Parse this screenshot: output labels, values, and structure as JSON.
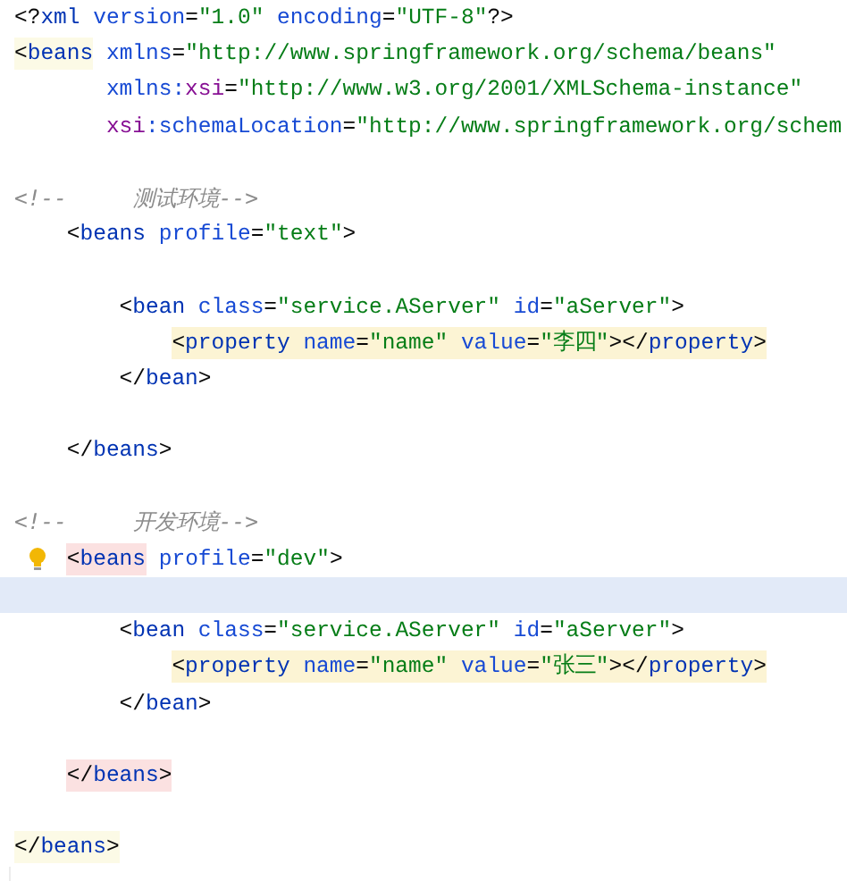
{
  "editor": {
    "lines": [
      {
        "kind": "code",
        "current": false,
        "bulb": false,
        "segments": [
          {
            "highlighted": false,
            "tokens": [
              {
                "kind": "punct",
                "text": "<?"
              },
              {
                "kind": "tag",
                "text": "xml"
              },
              {
                "kind": "attr",
                "text": " version"
              },
              {
                "kind": "punct",
                "text": "="
              },
              {
                "kind": "value",
                "text": "\"1.0\""
              },
              {
                "kind": "attr",
                "text": " encoding"
              },
              {
                "kind": "punct",
                "text": "="
              },
              {
                "kind": "value",
                "text": "\"UTF-8\""
              },
              {
                "kind": "punct",
                "text": "?>"
              }
            ]
          }
        ]
      },
      {
        "kind": "code",
        "current": false,
        "bulb": false,
        "segments": [
          {
            "highlighted": true,
            "color": "#fcfae6",
            "tokens": [
              {
                "kind": "punct",
                "text": "<"
              },
              {
                "kind": "tag",
                "text": "beans"
              }
            ]
          },
          {
            "highlighted": false,
            "tokens": [
              {
                "kind": "attr",
                "text": " xmlns"
              },
              {
                "kind": "punct",
                "text": "="
              },
              {
                "kind": "value",
                "text": "\"http://www.springframework.org/schema/beans\""
              }
            ]
          }
        ],
        "children": [
          {
            "kind": "continuation",
            "current": false,
            "bulb": false,
            "segments": [
              {
                "highlighted": false,
                "tokens": [
                  {
                    "kind": "attr",
                    "text": "xmlns:"
                  },
                  {
                    "kind": "ns",
                    "text": "xsi"
                  },
                  {
                    "kind": "punct",
                    "text": "="
                  },
                  {
                    "kind": "value",
                    "text": "\"http://www.w3.org/2001/XMLSchema-instance\""
                  }
                ]
              }
            ]
          },
          {
            "kind": "continuation",
            "current": false,
            "bulb": false,
            "segments": [
              {
                "highlighted": false,
                "tokens": [
                  {
                    "kind": "ns",
                    "text": "xsi"
                  },
                  {
                    "kind": "attr",
                    "text": ":schemaLocation"
                  },
                  {
                    "kind": "punct",
                    "text": "="
                  },
                  {
                    "kind": "value",
                    "text": "\"http://www.springframework.org/schem"
                  }
                ]
              }
            ]
          },
          {
            "kind": "blank",
            "current": false,
            "bulb": false
          },
          {
            "kind": "comment",
            "current": false,
            "bulb": false,
            "segments": [
              {
                "highlighted": false,
                "tokens": [
                  {
                    "kind": "comment",
                    "text": "<!--     测试环境-->"
                  }
                ]
              }
            ]
          },
          {
            "kind": "code",
            "current": false,
            "bulb": false,
            "segments": [
              {
                "highlighted": false,
                "tokens": [
                  {
                    "kind": "punct",
                    "text": "<"
                  },
                  {
                    "kind": "tag",
                    "text": "beans"
                  },
                  {
                    "kind": "attr",
                    "text": " profile"
                  },
                  {
                    "kind": "punct",
                    "text": "="
                  },
                  {
                    "kind": "value",
                    "text": "\"text\""
                  },
                  {
                    "kind": "punct",
                    "text": ">"
                  }
                ]
              }
            ],
            "children": [
              {
                "kind": "blank",
                "current": false,
                "bulb": false
              },
              {
                "kind": "code",
                "current": false,
                "bulb": false,
                "segments": [
                  {
                    "highlighted": false,
                    "tokens": [
                      {
                        "kind": "punct",
                        "text": "<"
                      },
                      {
                        "kind": "tag",
                        "text": "bean"
                      },
                      {
                        "kind": "attr",
                        "text": " class"
                      },
                      {
                        "kind": "punct",
                        "text": "="
                      },
                      {
                        "kind": "value",
                        "text": "\"service.AServer\""
                      },
                      {
                        "kind": "attr",
                        "text": " id"
                      },
                      {
                        "kind": "punct",
                        "text": "="
                      },
                      {
                        "kind": "value",
                        "text": "\"aServer\""
                      },
                      {
                        "kind": "punct",
                        "text": ">"
                      }
                    ]
                  }
                ],
                "children": [
                  {
                    "kind": "code",
                    "current": false,
                    "bulb": false,
                    "segments": [
                      {
                        "highlighted": true,
                        "color": "#fcf4d4",
                        "tokens": [
                          {
                            "kind": "punct",
                            "text": "<"
                          },
                          {
                            "kind": "tag",
                            "text": "property"
                          },
                          {
                            "kind": "attr",
                            "text": " name"
                          },
                          {
                            "kind": "punct",
                            "text": "="
                          },
                          {
                            "kind": "value",
                            "text": "\"name\""
                          },
                          {
                            "kind": "attr",
                            "text": " value"
                          },
                          {
                            "kind": "punct",
                            "text": "="
                          },
                          {
                            "kind": "value",
                            "text": "\"李四\""
                          },
                          {
                            "kind": "punct",
                            "text": "></"
                          },
                          {
                            "kind": "tag",
                            "text": "property"
                          },
                          {
                            "kind": "punct",
                            "text": ">"
                          }
                        ]
                      }
                    ]
                  }
                ]
              },
              {
                "kind": "code",
                "current": false,
                "bulb": false,
                "segments": [
                  {
                    "highlighted": false,
                    "tokens": [
                      {
                        "kind": "punct",
                        "text": "</"
                      },
                      {
                        "kind": "tag",
                        "text": "bean"
                      },
                      {
                        "kind": "punct",
                        "text": ">"
                      }
                    ]
                  }
                ]
              },
              {
                "kind": "blank",
                "current": false,
                "bulb": false
              }
            ]
          },
          {
            "kind": "code",
            "current": false,
            "bulb": false,
            "segments": [
              {
                "highlighted": false,
                "tokens": [
                  {
                    "kind": "punct",
                    "text": "</"
                  },
                  {
                    "kind": "tag",
                    "text": "beans"
                  },
                  {
                    "kind": "punct",
                    "text": ">"
                  }
                ]
              }
            ]
          },
          {
            "kind": "blank",
            "current": false,
            "bulb": false
          },
          {
            "kind": "comment",
            "current": false,
            "bulb": false,
            "segments": [
              {
                "highlighted": false,
                "tokens": [
                  {
                    "kind": "comment",
                    "text": "<!--     开发环境-->"
                  }
                ]
              }
            ]
          },
          {
            "kind": "code",
            "current": false,
            "bulb": true,
            "segments": [
              {
                "highlighted": true,
                "color": "#fbe1e1",
                "tokens": [
                  {
                    "kind": "punct",
                    "text": "<"
                  },
                  {
                    "kind": "tag",
                    "text": "beans"
                  }
                ]
              },
              {
                "highlighted": false,
                "tokens": [
                  {
                    "kind": "attr",
                    "text": " profile"
                  },
                  {
                    "kind": "punct",
                    "text": "="
                  },
                  {
                    "kind": "value",
                    "text": "\"dev\""
                  },
                  {
                    "kind": "punct",
                    "text": ">"
                  }
                ]
              }
            ],
            "children": [
              {
                "kind": "blank",
                "current": true,
                "bulb": false
              },
              {
                "kind": "code",
                "current": false,
                "bulb": false,
                "segments": [
                  {
                    "highlighted": false,
                    "tokens": [
                      {
                        "kind": "punct",
                        "text": "<"
                      },
                      {
                        "kind": "tag",
                        "text": "bean"
                      },
                      {
                        "kind": "attr",
                        "text": " class"
                      },
                      {
                        "kind": "punct",
                        "text": "="
                      },
                      {
                        "kind": "value",
                        "text": "\"service.AServer\""
                      },
                      {
                        "kind": "attr",
                        "text": " id"
                      },
                      {
                        "kind": "punct",
                        "text": "="
                      },
                      {
                        "kind": "value",
                        "text": "\"aServer\""
                      },
                      {
                        "kind": "punct",
                        "text": ">"
                      }
                    ]
                  }
                ],
                "children": [
                  {
                    "kind": "code",
                    "current": false,
                    "bulb": false,
                    "segments": [
                      {
                        "highlighted": true,
                        "color": "#fcf4d4",
                        "tokens": [
                          {
                            "kind": "punct",
                            "text": "<"
                          },
                          {
                            "kind": "tag",
                            "text": "property"
                          },
                          {
                            "kind": "attr",
                            "text": " name"
                          },
                          {
                            "kind": "punct",
                            "text": "="
                          },
                          {
                            "kind": "value",
                            "text": "\"name\""
                          },
                          {
                            "kind": "attr",
                            "text": " value"
                          },
                          {
                            "kind": "punct",
                            "text": "="
                          },
                          {
                            "kind": "value",
                            "text": "\"张三\""
                          },
                          {
                            "kind": "punct",
                            "text": "></"
                          },
                          {
                            "kind": "tag",
                            "text": "property"
                          },
                          {
                            "kind": "punct",
                            "text": ">"
                          }
                        ]
                      }
                    ]
                  }
                ]
              },
              {
                "kind": "code",
                "current": false,
                "bulb": false,
                "segments": [
                  {
                    "highlighted": false,
                    "tokens": [
                      {
                        "kind": "punct",
                        "text": "</"
                      },
                      {
                        "kind": "tag",
                        "text": "bean"
                      },
                      {
                        "kind": "punct",
                        "text": ">"
                      }
                    ]
                  }
                ]
              },
              {
                "kind": "blank",
                "current": false,
                "bulb": false
              }
            ]
          },
          {
            "kind": "code",
            "current": false,
            "bulb": false,
            "segments": [
              {
                "highlighted": true,
                "color": "#fbe1e1",
                "tokens": [
                  {
                    "kind": "punct",
                    "text": "</"
                  },
                  {
                    "kind": "tag",
                    "text": "beans"
                  },
                  {
                    "kind": "punct",
                    "text": ">"
                  }
                ]
              }
            ]
          },
          {
            "kind": "blank",
            "current": false,
            "bulb": false
          }
        ]
      },
      {
        "kind": "code",
        "current": false,
        "bulb": false,
        "segments": [
          {
            "highlighted": true,
            "color": "#fcfae6",
            "tokens": [
              {
                "kind": "punct",
                "text": "</"
              },
              {
                "kind": "tag",
                "text": "beans"
              },
              {
                "kind": "punct",
                "text": ">"
              }
            ]
          }
        ]
      }
    ]
  }
}
